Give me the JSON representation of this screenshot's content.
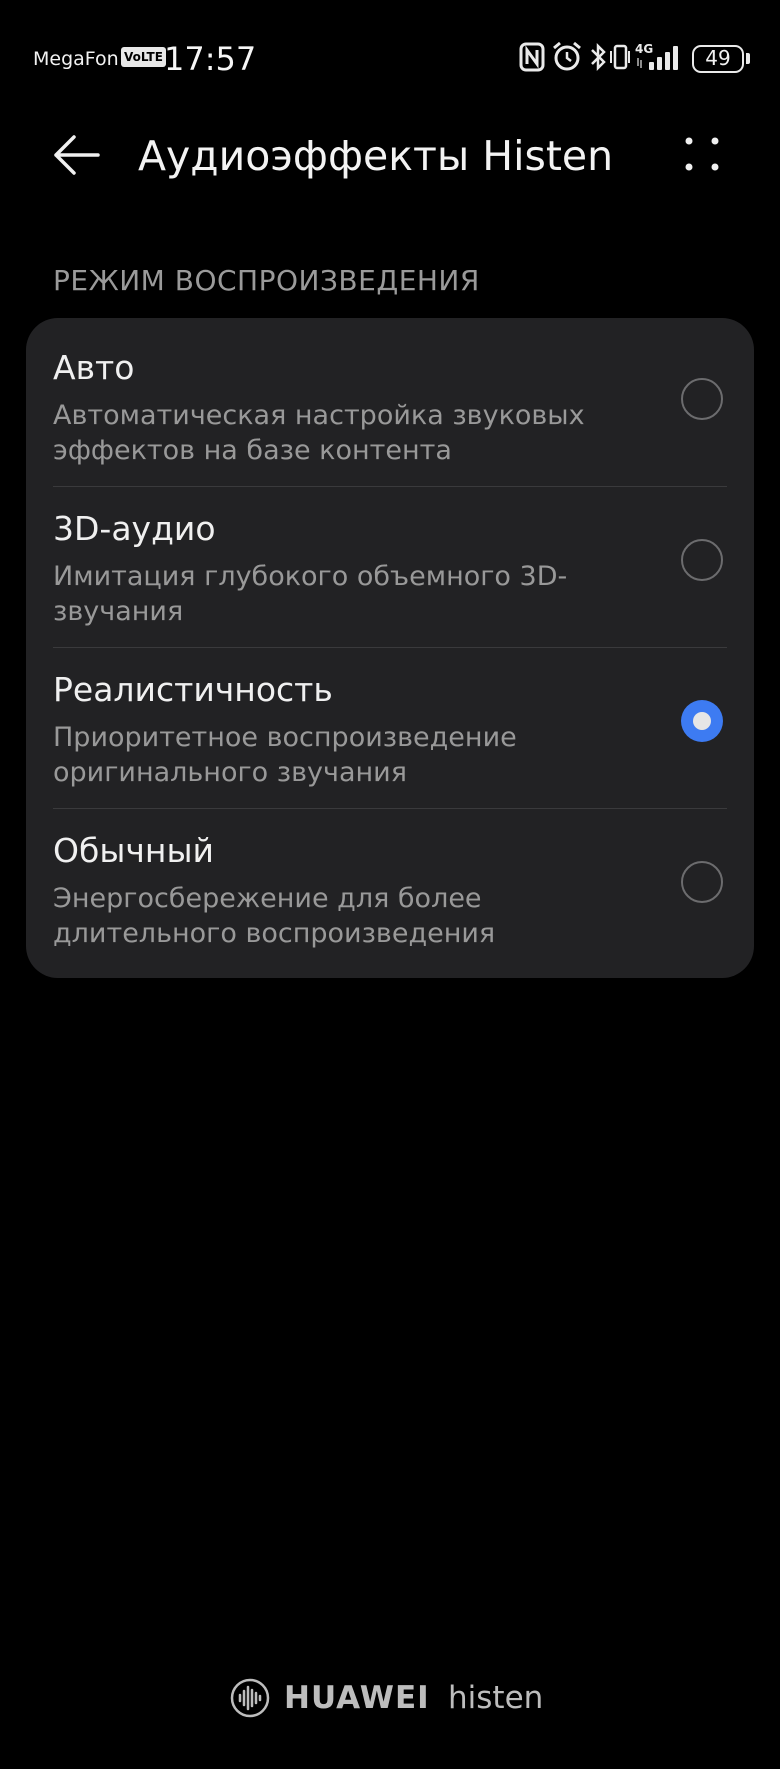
{
  "status_bar": {
    "carrier": "MegaFon",
    "volte": "VoLTE",
    "time": "17:57",
    "network": "4G",
    "battery": "49",
    "icons": [
      "nfc-icon",
      "alarm-icon",
      "bluetooth-icon",
      "vibrate-icon",
      "signal-icon",
      "battery-icon"
    ]
  },
  "header": {
    "title": "Аудиоэффекты Histen"
  },
  "section": {
    "title": "РЕЖИМ ВОСПРОИЗВЕДЕНИЯ"
  },
  "options": [
    {
      "title": "Авто",
      "description": "Автоматическая настройка звуковых эффектов на базе контента",
      "selected": false
    },
    {
      "title": "3D-аудио",
      "description": "Имитация глубокого объемного 3D-звучания",
      "selected": false
    },
    {
      "title": "Реалистичность",
      "description": "Приоритетное воспроизведение оригинального звучания",
      "selected": true
    },
    {
      "title": "Обычный",
      "description": "Энергосбережение для более длительного воспроизведения",
      "selected": false
    }
  ],
  "footer": {
    "brand": "HUAWEI",
    "product": "histen"
  },
  "colors": {
    "background": "#000000",
    "card": "#222224",
    "accent": "#3d7bf2",
    "secondary_text": "#999999"
  }
}
